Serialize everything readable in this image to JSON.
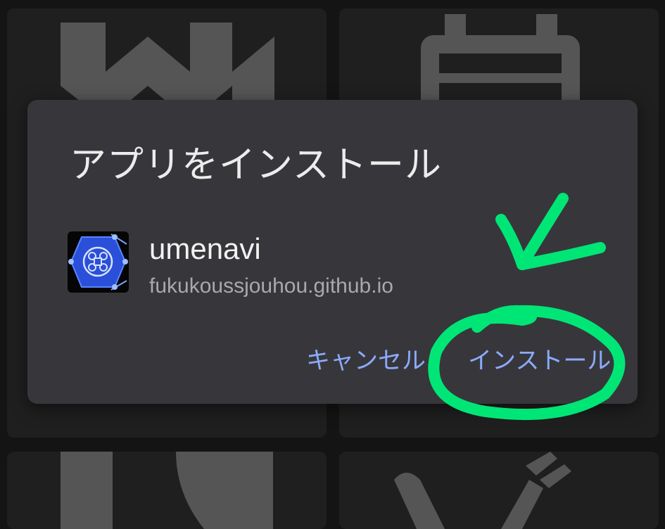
{
  "dialog": {
    "title": "アプリをインストール",
    "app": {
      "name": "umenavi",
      "url": "fukukoussjouhou.github.io",
      "icon": "umenavi-hexagon-logo-icon"
    },
    "buttons": {
      "cancel": "キャンセル",
      "install": "インストール"
    }
  },
  "background_tiles": [
    {
      "icon": "menu-grid-icon"
    },
    {
      "icon": "calendar-icon"
    },
    {
      "icon": "book-icon"
    },
    {
      "icon": "fork-knife-icon"
    }
  ],
  "annotation": {
    "type": "hand-drawn arrow and circle",
    "color": "#00e676",
    "target": "install-button"
  },
  "colors": {
    "dialog_bg": "#37373b",
    "button_text": "#8cabff",
    "page_bg": "#141414",
    "tile_bg": "#1f1f1f"
  }
}
